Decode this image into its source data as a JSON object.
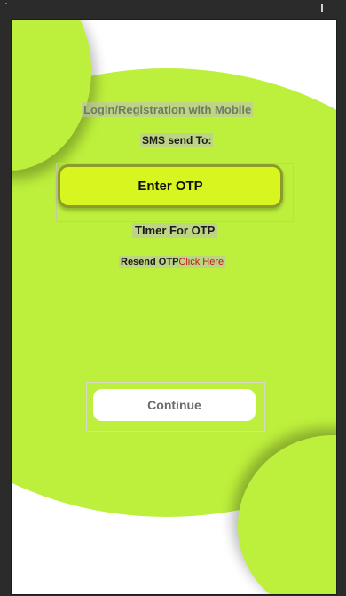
{
  "screen": {
    "title": "Login/Registration with Mobile",
    "sms_label": "SMS send To:",
    "otp_placeholder": "Enter OTP",
    "timer_label": "TImer For OTP",
    "resend_prefix": "Resend OTP",
    "resend_link": "Click Here",
    "continue_label": "Continue"
  },
  "colors": {
    "accent": "#bdf03c",
    "otp_field": "#d8f520",
    "link": "#c01a1a"
  }
}
